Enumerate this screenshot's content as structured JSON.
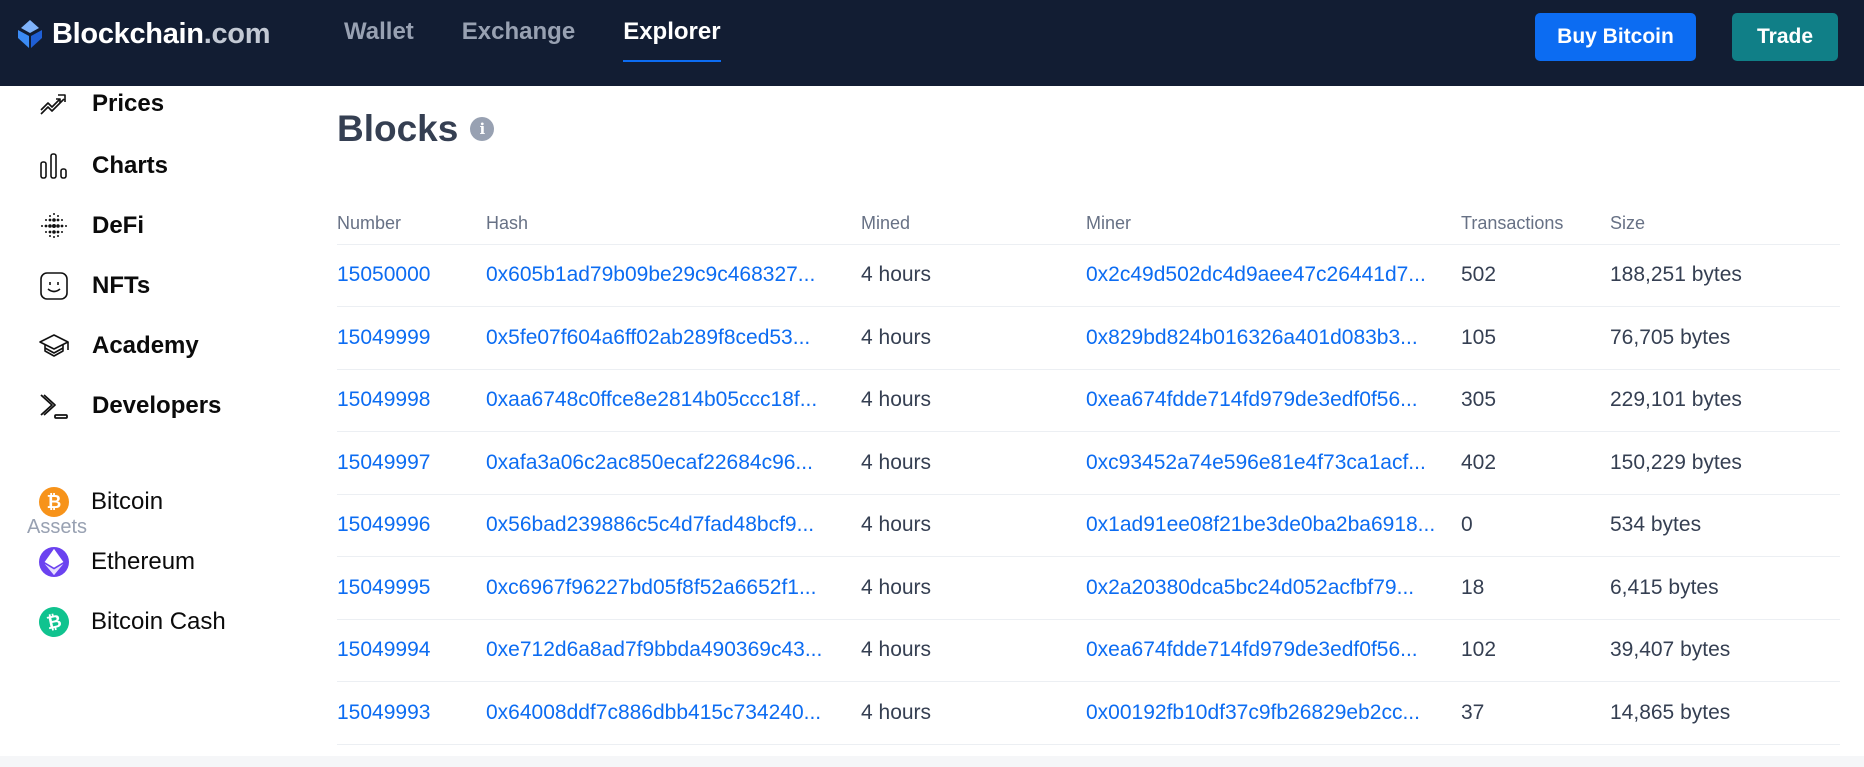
{
  "header": {
    "logo_brand": "Blockchain",
    "logo_tld": ".com",
    "nav": [
      {
        "label": "Wallet",
        "active": false
      },
      {
        "label": "Exchange",
        "active": false
      },
      {
        "label": "Explorer",
        "active": true
      }
    ],
    "buy_button": "Buy Bitcoin",
    "trade_button": "Trade"
  },
  "colors": {
    "topbar": "#121d33",
    "accent_blue": "#0c6cf2",
    "trade_teal": "#107f87",
    "bitcoin": "#f7931a",
    "ethereum": "#6b42f0",
    "bitcoin_cash": "#10c38f"
  },
  "sidebar": {
    "items": [
      {
        "label": "Prices",
        "icon": "trending-up-icon"
      },
      {
        "label": "Charts",
        "icon": "bar-chart-icon"
      },
      {
        "label": "DeFi",
        "icon": "dots-grid-icon"
      },
      {
        "label": "NFTs",
        "icon": "smiley-face-icon"
      },
      {
        "label": "Academy",
        "icon": "graduation-cap-icon"
      },
      {
        "label": "Developers",
        "icon": "terminal-icon"
      }
    ],
    "assets_heading": "Assets",
    "assets": [
      {
        "label": "Bitcoin",
        "icon": "bitcoin-icon",
        "glyph": "₿"
      },
      {
        "label": "Ethereum",
        "icon": "ethereum-icon",
        "glyph": "◆"
      },
      {
        "label": "Bitcoin Cash",
        "icon": "bitcoin-cash-icon",
        "glyph": "₿"
      }
    ]
  },
  "main": {
    "title": "Blocks",
    "info_glyph": "i",
    "table": {
      "headers": [
        "Number",
        "Hash",
        "Mined",
        "Miner",
        "Transactions",
        "Size"
      ],
      "rows": [
        {
          "number": "15050000",
          "hash": "0x605b1ad79b09be29c9c468327...",
          "mined": "4 hours",
          "miner": "0x2c49d502dc4d9aee47c26441d7...",
          "transactions": "502",
          "size": "188,251 bytes"
        },
        {
          "number": "15049999",
          "hash": "0x5fe07f604a6ff02ab289f8ced53...",
          "mined": "4 hours",
          "miner": "0x829bd824b016326a401d083b3...",
          "transactions": "105",
          "size": "76,705 bytes"
        },
        {
          "number": "15049998",
          "hash": "0xaa6748c0ffce8e2814b05ccc18f...",
          "mined": "4 hours",
          "miner": "0xea674fdde714fd979de3edf0f56...",
          "transactions": "305",
          "size": "229,101 bytes"
        },
        {
          "number": "15049997",
          "hash": "0xafa3a06c2ac850ecaf22684c96...",
          "mined": "4 hours",
          "miner": "0xc93452a74e596e81e4f73ca1acf...",
          "transactions": "402",
          "size": "150,229 bytes"
        },
        {
          "number": "15049996",
          "hash": "0x56bad239886c5c4d7fad48bcf9...",
          "mined": "4 hours",
          "miner": "0x1ad91ee08f21be3de0ba2ba6918...",
          "transactions": "0",
          "size": "534 bytes"
        },
        {
          "number": "15049995",
          "hash": "0xc6967f96227bd05f8f52a6652f1...",
          "mined": "4 hours",
          "miner": "0x2a20380dca5bc24d052acfbf79...",
          "transactions": "18",
          "size": "6,415 bytes"
        },
        {
          "number": "15049994",
          "hash": "0xe712d6a8ad7f9bbda490369c43...",
          "mined": "4 hours",
          "miner": "0xea674fdde714fd979de3edf0f56...",
          "transactions": "102",
          "size": "39,407 bytes"
        },
        {
          "number": "15049993",
          "hash": "0x64008ddf7c886dbb415c734240...",
          "mined": "4 hours",
          "miner": "0x00192fb10df37c9fb26829eb2cc...",
          "transactions": "37",
          "size": "14,865 bytes"
        }
      ]
    }
  }
}
